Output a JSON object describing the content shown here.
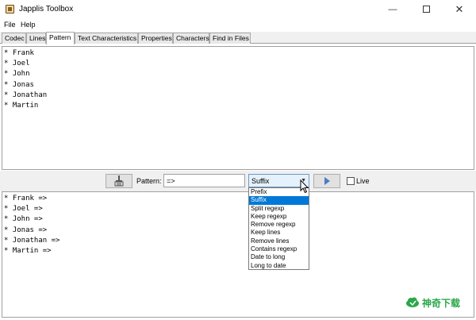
{
  "window": {
    "title": "Japplis Toolbox",
    "minimize": "—",
    "close": "✕"
  },
  "menu": [
    {
      "label": "File"
    },
    {
      "label": "Help"
    }
  ],
  "tabs": [
    {
      "label": "Codec"
    },
    {
      "label": "Lines"
    },
    {
      "label": "Pattern"
    },
    {
      "label": "Text Characteristics"
    },
    {
      "label": "Properties"
    },
    {
      "label": "Characters"
    },
    {
      "label": "Find in Files"
    }
  ],
  "active_tab": "Pattern",
  "input_lines": [
    "* Frank",
    "* Joel",
    "* John",
    "* Jonas",
    "* Jonathan",
    "* Martin"
  ],
  "controls": {
    "clear_icon": "broom-icon",
    "pattern_label": "Pattern:",
    "pattern_value": "=>",
    "mode_selected": "Suffix",
    "run_icon": "play-icon",
    "live_label": "Live",
    "live_checked": false
  },
  "mode_options": [
    "Prefix",
    "Suffix",
    "Split regexp",
    "Keep regexp",
    "Remove regexp",
    "Keep lines",
    "Remove lines",
    "Contains regexp",
    "Date to long",
    "Long to date"
  ],
  "output_lines": [
    "* Frank =>",
    "* Joel =>",
    "* John =>",
    "* Jonas =>",
    "* Jonathan =>",
    "* Martin =>"
  ],
  "watermark": {
    "text": "神奇下载",
    "icon": "cloud-logo-icon",
    "color": "#2aa84a"
  },
  "colors": {
    "selection": "#0078d7",
    "combo_border": "#6b9ac9",
    "run_icon": "#4a7ec2"
  }
}
